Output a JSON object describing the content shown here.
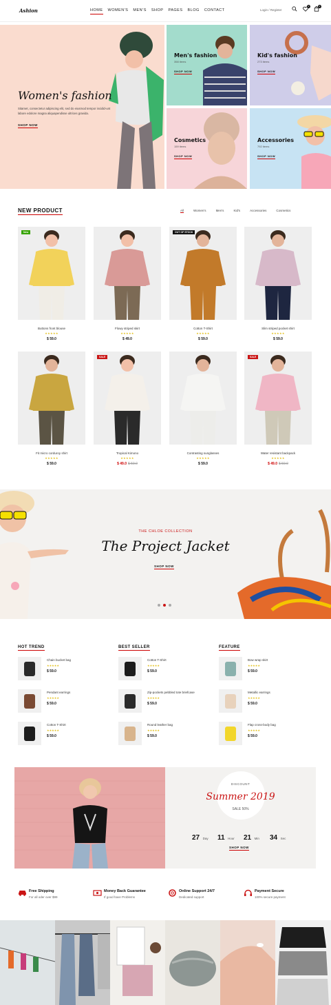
{
  "header": {
    "logo": "Ashion",
    "nav": [
      "HOME",
      "WOMEN'S",
      "MEN'S",
      "SHOP",
      "PAGES",
      "BLOG",
      "CONTACT"
    ],
    "account": "Login / Register",
    "wishlist_count": "2",
    "cart_count": "2"
  },
  "hero": {
    "main": {
      "title": "Women's fashion",
      "text": "Sitamet, consectetur adipiscing elit, sed do eiusmod tempor incidid-unt labore edolore magna aliquapendisse ultrices gravida.",
      "link": "SHOP NOW"
    },
    "tiles": [
      {
        "title": "Men's fashion",
        "items": "358 items",
        "link": "SHOP NOW"
      },
      {
        "title": "Kid's fashion",
        "items": "273 items",
        "link": "SHOP NOW"
      },
      {
        "title": "Cosmetics",
        "items": "159 items",
        "link": "SHOP NOW"
      },
      {
        "title": "Accessories",
        "items": "792 items",
        "link": "SHOP NOW"
      }
    ]
  },
  "new_product": {
    "title": "NEW PRODUCT",
    "filters": [
      "All",
      "Women's",
      "Men's",
      "Kid's",
      "Accessories",
      "Cosmetics"
    ],
    "stars": "★★★★★",
    "products": [
      {
        "name": "Buttons front blouse",
        "price": "$ 59.0",
        "old": "",
        "tag": "New",
        "tag_color": "#36a300"
      },
      {
        "name": "Flowy striped skirt",
        "price": "$ 49.0",
        "old": "",
        "tag": "",
        "tag_color": ""
      },
      {
        "name": "Cotton T-Shirt",
        "price": "$ 59.0",
        "old": "",
        "tag": "OUT OF STOCK",
        "tag_color": "#111111"
      },
      {
        "name": "Slim striped pocket shirt",
        "price": "$ 59.0",
        "old": "",
        "tag": "",
        "tag_color": ""
      },
      {
        "name": "Fit micro corduroy shirt",
        "price": "$ 59.0",
        "old": "",
        "tag": "",
        "tag_color": ""
      },
      {
        "name": "Tropical Kimono",
        "price": "$ 49.0",
        "old": "$ 59.0",
        "tag": "SALE",
        "tag_color": "#ca1515"
      },
      {
        "name": "Contrasting sunglasses",
        "price": "$ 59.0",
        "old": "",
        "tag": "",
        "tag_color": ""
      },
      {
        "name": "Water resistant backpack",
        "price": "$ 49.0",
        "old": "$ 59.0",
        "tag": "SALE",
        "tag_color": "#ca1515"
      }
    ]
  },
  "banner": {
    "kicker": "THE CHLOE COLLECTION",
    "title": "The Project Jacket",
    "link": "SHOP NOW"
  },
  "lists": [
    {
      "title": "HOT TREND",
      "items": [
        {
          "name": "Chain bucket bag",
          "price": "$ 59.0"
        },
        {
          "name": "Pendant earrings",
          "price": "$ 59.0"
        },
        {
          "name": "Cotton T-Shirt",
          "price": "$ 59.0"
        }
      ]
    },
    {
      "title": "BEST SELLER",
      "items": [
        {
          "name": "Cotton T-Shirt",
          "price": "$ 59.0"
        },
        {
          "name": "Zip-pockets pebbled tote briefcase",
          "price": "$ 59.0"
        },
        {
          "name": "Round leather bag",
          "price": "$ 59.0"
        }
      ]
    },
    {
      "title": "FEATURE",
      "items": [
        {
          "name": "Bow wrap skirt",
          "price": "$ 59.0"
        },
        {
          "name": "Metallic earrings",
          "price": "$ 59.0"
        },
        {
          "name": "Flap cross-body bag",
          "price": "$ 59.0"
        }
      ]
    }
  ],
  "discount": {
    "kicker": "DISCOUNT",
    "title": "Summer 2019",
    "sale": "SALE 50%",
    "countdown": [
      {
        "n": "27",
        "u": "Day"
      },
      {
        "n": "11",
        "u": "Hour"
      },
      {
        "n": "21",
        "u": "Min"
      },
      {
        "n": "34",
        "u": "Sec"
      }
    ],
    "link": "SHOP NOW"
  },
  "services": [
    {
      "title": "Free Shipping",
      "text": "For all oder over $99"
    },
    {
      "title": "Money Back Guarantee",
      "text": "If good have Problems"
    },
    {
      "title": "Online Support 24/7",
      "text": "Dedicated support"
    },
    {
      "title": "Payment Secure",
      "text": "100% secure payment"
    }
  ],
  "colors": {
    "accent": "#ca1515",
    "star": "#e3c01c"
  }
}
